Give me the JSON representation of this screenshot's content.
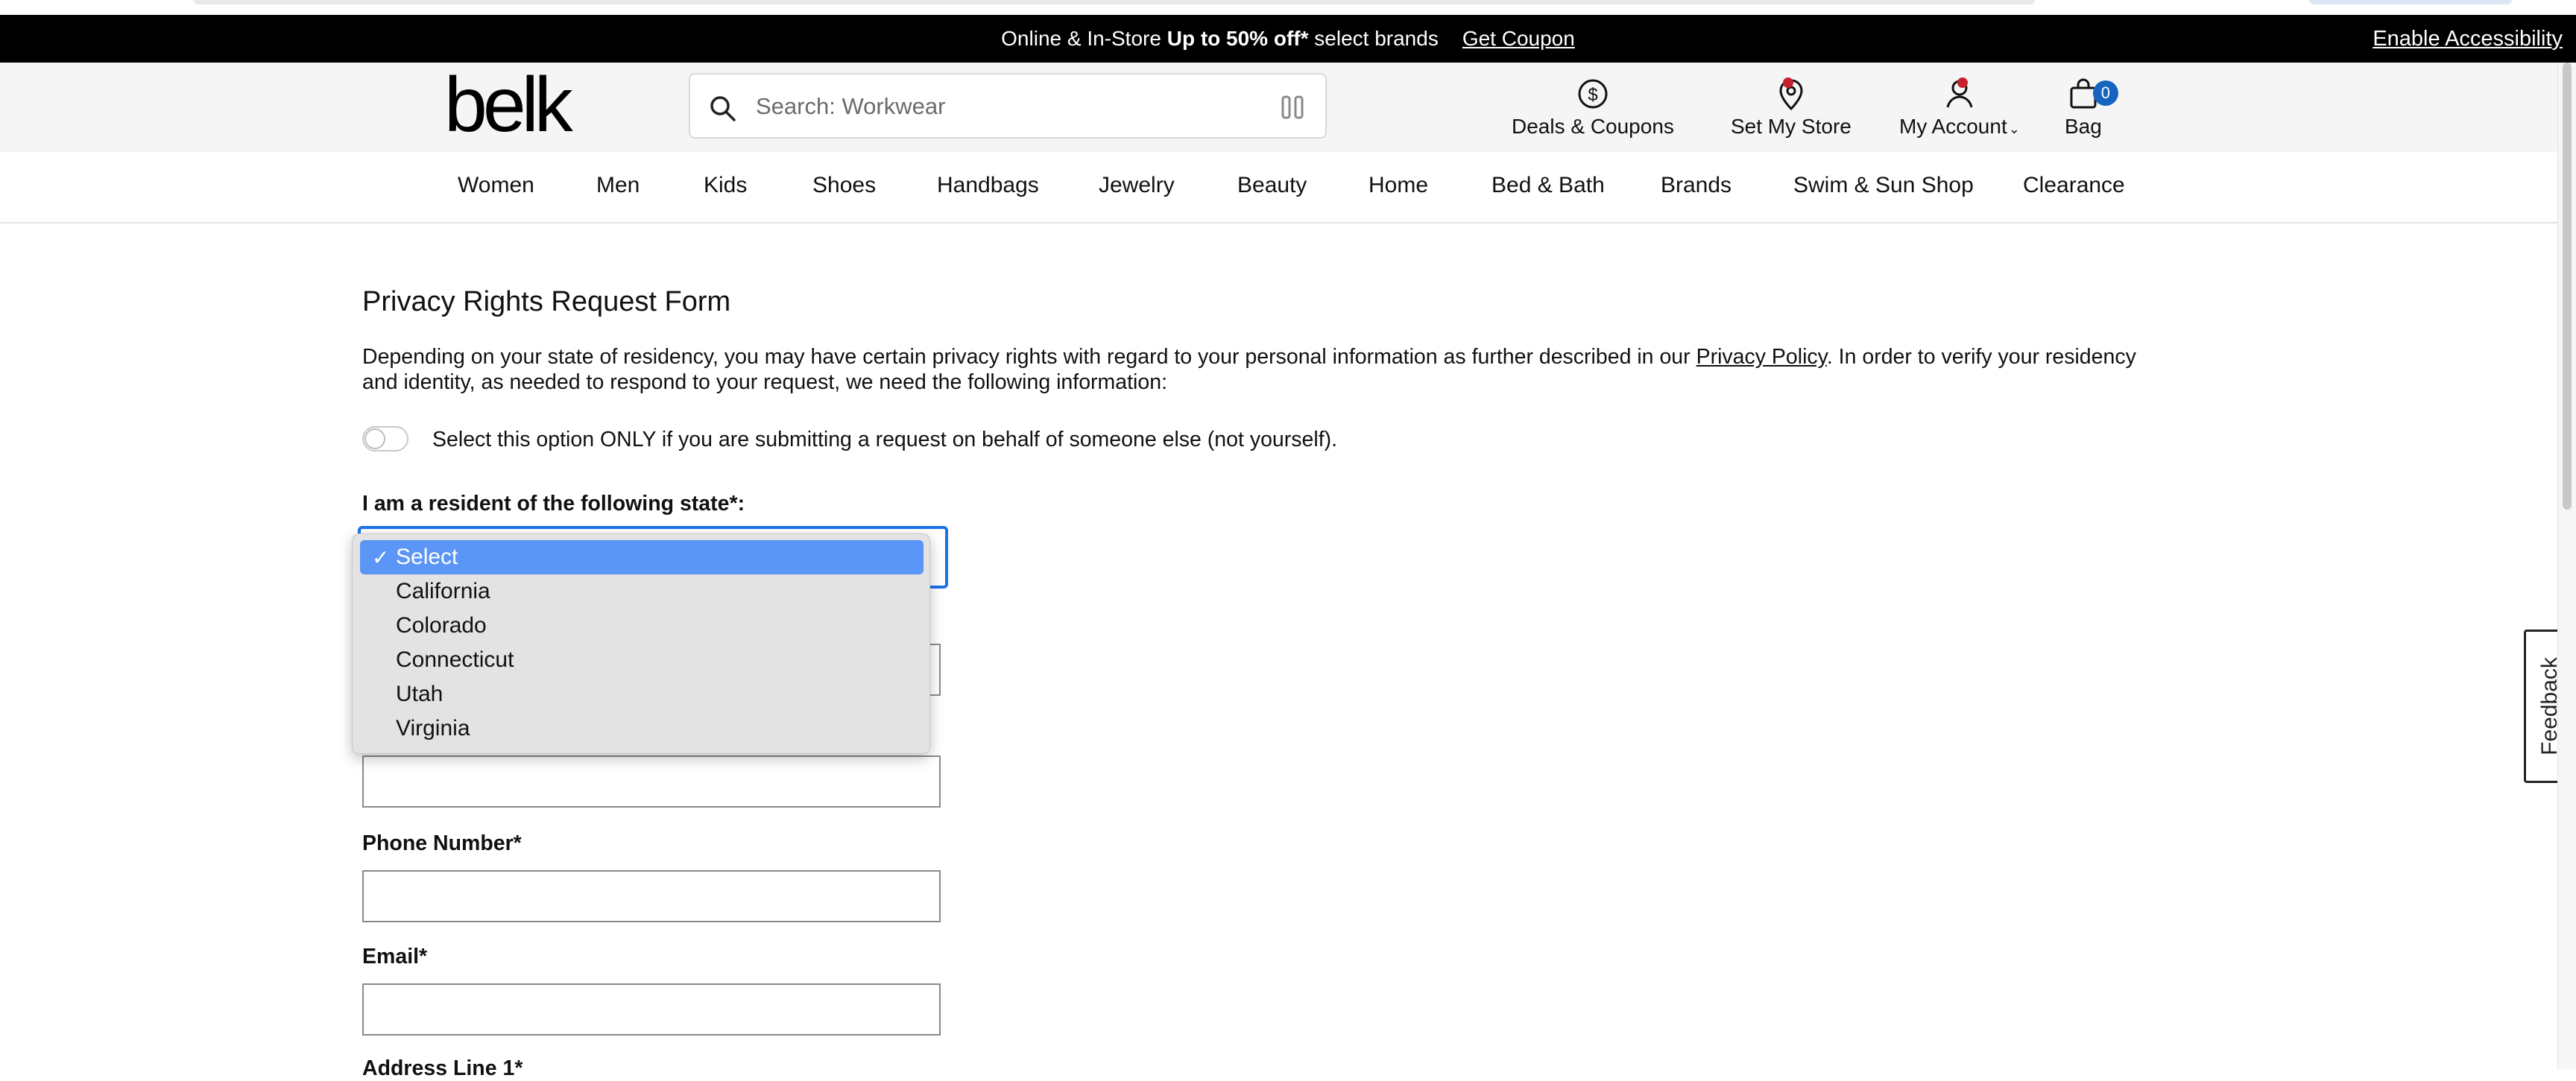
{
  "promo": {
    "text_prefix": "Online & In-Store ",
    "text_bold": "Up to 50% off*",
    "text_suffix": " select brands",
    "coupon_link": "Get Coupon",
    "accessibility_link": "Enable Accessibility"
  },
  "header": {
    "logo": "belk",
    "search_placeholder": "Search: Workwear",
    "deals_label": "Deals & Coupons",
    "store_label": "Set My Store",
    "account_label": "My Account",
    "bag_label": "Bag",
    "bag_count": "0"
  },
  "nav": {
    "items": [
      "Women",
      "Men",
      "Kids",
      "Shoes",
      "Handbags",
      "Jewelry",
      "Beauty",
      "Home",
      "Bed & Bath",
      "Brands",
      "Swim & Sun Shop",
      "Clearance"
    ]
  },
  "form": {
    "title": "Privacy Rights Request Form",
    "intro_before_link": "Depending on your state of residency, you may have certain privacy rights with regard to your personal information as further described in our ",
    "intro_link": "Privacy Policy",
    "intro_after_link": ". In order to verify your residency and identity, as needed to respond to your request, we need the following information:",
    "toggle_label": "Select this option ONLY if you are submitting a request on behalf of someone else (not yourself).",
    "state_label": "I am a resident of the following state*:",
    "phone_label": "Phone Number*",
    "email_label": "Email*",
    "address_label": "Address Line 1*"
  },
  "dropdown": {
    "check": "✓",
    "options": [
      "Select",
      "California",
      "Colorado",
      "Connecticut",
      "Utah",
      "Virginia"
    ],
    "selected": "Select"
  },
  "feedback_label": "Feedback",
  "colors": {
    "promo_bg": "#000000",
    "header_bg": "#f5f5f5",
    "focus_blue": "#1a73e8",
    "selected_option": "#5b95f5",
    "badge_blue": "#1565c0",
    "notify_red": "#c7202f"
  }
}
